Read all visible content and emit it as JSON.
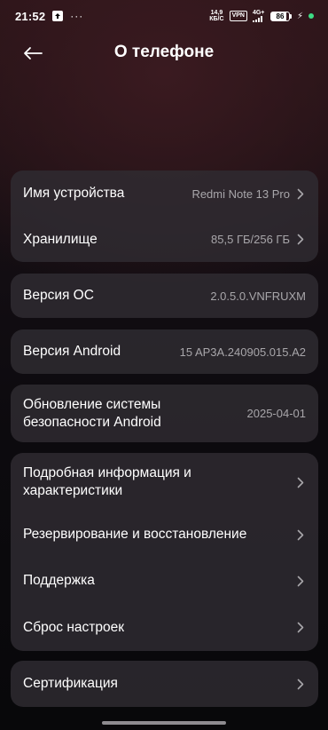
{
  "status_bar": {
    "time": "21:52",
    "dots": "···",
    "net_speed_value": "14,9",
    "net_speed_unit": "КБ/С",
    "vpn": "VPN",
    "signal": "4G+",
    "battery": "86"
  },
  "header": {
    "title": "О телефоне"
  },
  "groups": {
    "device": {
      "name_label": "Имя устройства",
      "name_value": "Redmi Note 13 Pro",
      "storage_label": "Хранилище",
      "storage_value": "85,5 ГБ/256 ГБ"
    },
    "os": {
      "label": "Версия ОС",
      "value": "2.0.5.0.VNFRUXM"
    },
    "android": {
      "label": "Версия Android",
      "value": "15 AP3A.240905.015.A2"
    },
    "security": {
      "label_line1": "Обновление системы",
      "label_line2": "безопасности Android",
      "value": "2025-04-01"
    },
    "more": {
      "details_line1": "Подробная информация и",
      "details_line2": "характеристики",
      "backup": "Резервирование и восстановление",
      "support": "Поддержка",
      "reset": "Сброс настроек"
    },
    "cert": {
      "label": "Сертификация"
    }
  },
  "colors": {
    "card_bg": "#302c32",
    "value_text": "#a8a6aa",
    "accent_dot": "#3ddc84"
  },
  "icons": {
    "back": "arrow-left-icon",
    "chevron": "chevron-right-icon"
  }
}
